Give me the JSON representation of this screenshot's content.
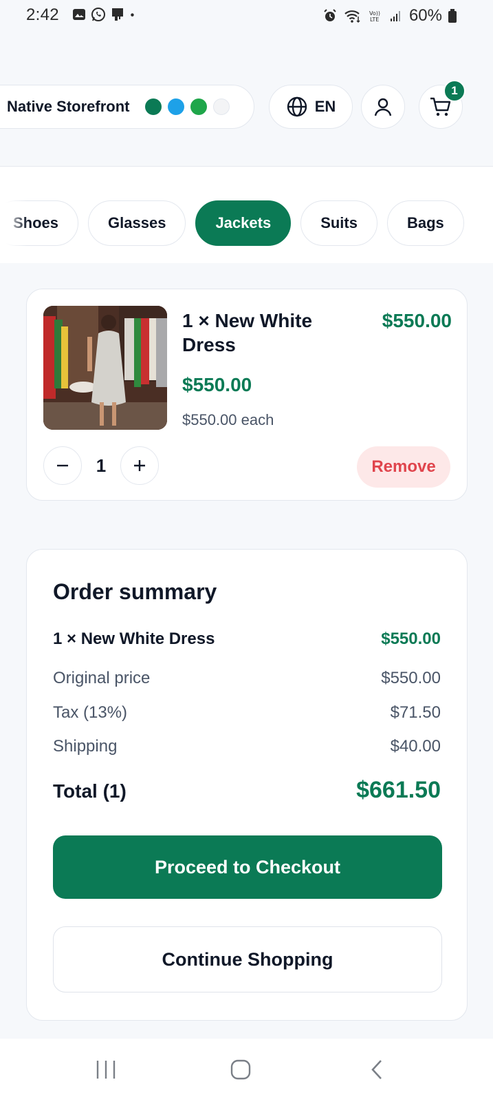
{
  "status_bar": {
    "time": "2:42",
    "battery": "60%",
    "left_icons": [
      "gallery-icon",
      "whatsapp-icon",
      "notification-icon",
      "dot-icon"
    ],
    "right_icons": [
      "alarm-icon",
      "wifi-icon",
      "volte-icon",
      "signal-icon",
      "battery-icon"
    ]
  },
  "header": {
    "store_name": "Native Storefront",
    "theme_swatches": [
      "#0b7a55",
      "#1ea1e8",
      "#1fa64a",
      "#f3f4f6"
    ],
    "language": "EN",
    "cart_count": "1"
  },
  "categories": {
    "items": [
      "Shoes",
      "Glasses",
      "Jackets",
      "Suits",
      "Bags"
    ],
    "active": "Jackets"
  },
  "cart_item": {
    "title": "1 × New White Dress",
    "line_total": "$550.00",
    "price": "$550.00",
    "each": "$550.00 each",
    "quantity": "1",
    "remove_label": "Remove"
  },
  "summary": {
    "title": "Order summary",
    "item_label": "1 × New White Dress",
    "item_value": "$550.00",
    "original_label": "Original price",
    "original_value": "$550.00",
    "tax_label": "Tax (13%)",
    "tax_value": "$71.50",
    "shipping_label": "Shipping",
    "shipping_value": "$40.00",
    "total_label": "Total (1)",
    "total_value": "$661.50",
    "checkout_label": "Proceed to Checkout",
    "continue_label": "Continue Shopping"
  },
  "colors": {
    "brand": "#0b7a55",
    "danger": "#e0454d",
    "danger_bg": "#fde8e8"
  }
}
